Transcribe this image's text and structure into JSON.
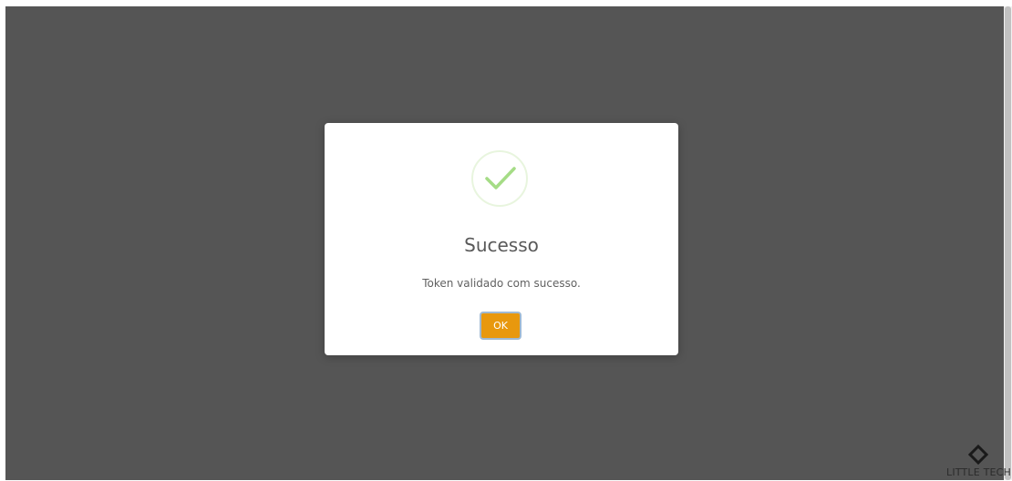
{
  "modal": {
    "title": "Sucesso",
    "message": "Token validado com sucesso.",
    "ok_label": "OK",
    "icon": "checkmark-icon"
  },
  "brand": {
    "name": "LITTLE TECH",
    "icon": "diamond-icon"
  },
  "colors": {
    "backdrop": "#555555",
    "button": "#e8980e",
    "check": "#a5dc86"
  }
}
